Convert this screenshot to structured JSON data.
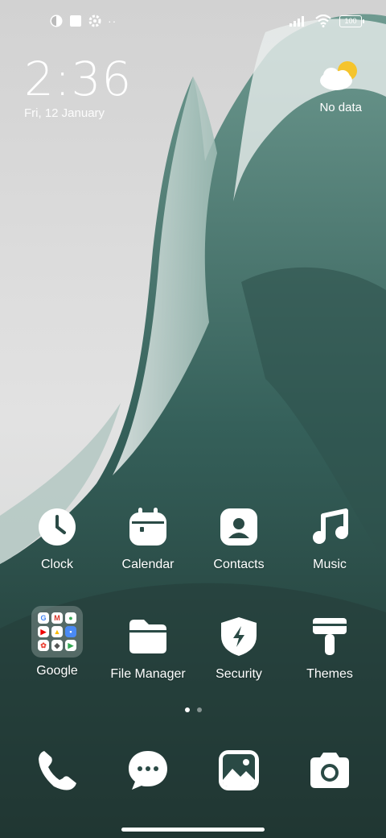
{
  "status_bar": {
    "left_icons": [
      "notification-app-icon",
      "square-notification-icon",
      "settings-gear-icon",
      "more-notifications-dots-icon"
    ],
    "battery_level": "100",
    "right_icons": [
      "signal-icon",
      "wifi-icon",
      "battery-icon"
    ]
  },
  "clock_widget": {
    "time": "2:36",
    "date": "Fri, 12 January"
  },
  "weather_widget": {
    "icon": "partly-cloudy-icon",
    "text": "No data"
  },
  "home_apps": [
    {
      "label": "Clock",
      "icon": "clock-icon"
    },
    {
      "label": "Calendar",
      "icon": "calendar-icon"
    },
    {
      "label": "Contacts",
      "icon": "contacts-icon"
    },
    {
      "label": "Music",
      "icon": "music-note-icon"
    },
    {
      "label": "Google",
      "icon": "google-folder-icon"
    },
    {
      "label": "File Manager",
      "icon": "folder-icon"
    },
    {
      "label": "Security",
      "icon": "shield-bolt-icon"
    },
    {
      "label": "Themes",
      "icon": "paint-roller-icon"
    }
  ],
  "google_folder_items": [
    "G",
    "M",
    "maps",
    "yt",
    "drive",
    "meet",
    "photos",
    "assistant",
    "play"
  ],
  "page_indicator": {
    "pages": 2,
    "current": 1
  },
  "dock": [
    {
      "icon": "phone-icon"
    },
    {
      "icon": "messages-icon"
    },
    {
      "icon": "gallery-icon"
    },
    {
      "icon": "camera-icon"
    }
  ],
  "colors": {
    "wave_dark": "#1f3a35",
    "wave_mid": "#5c8a80",
    "sky": "#dcdcdc"
  }
}
